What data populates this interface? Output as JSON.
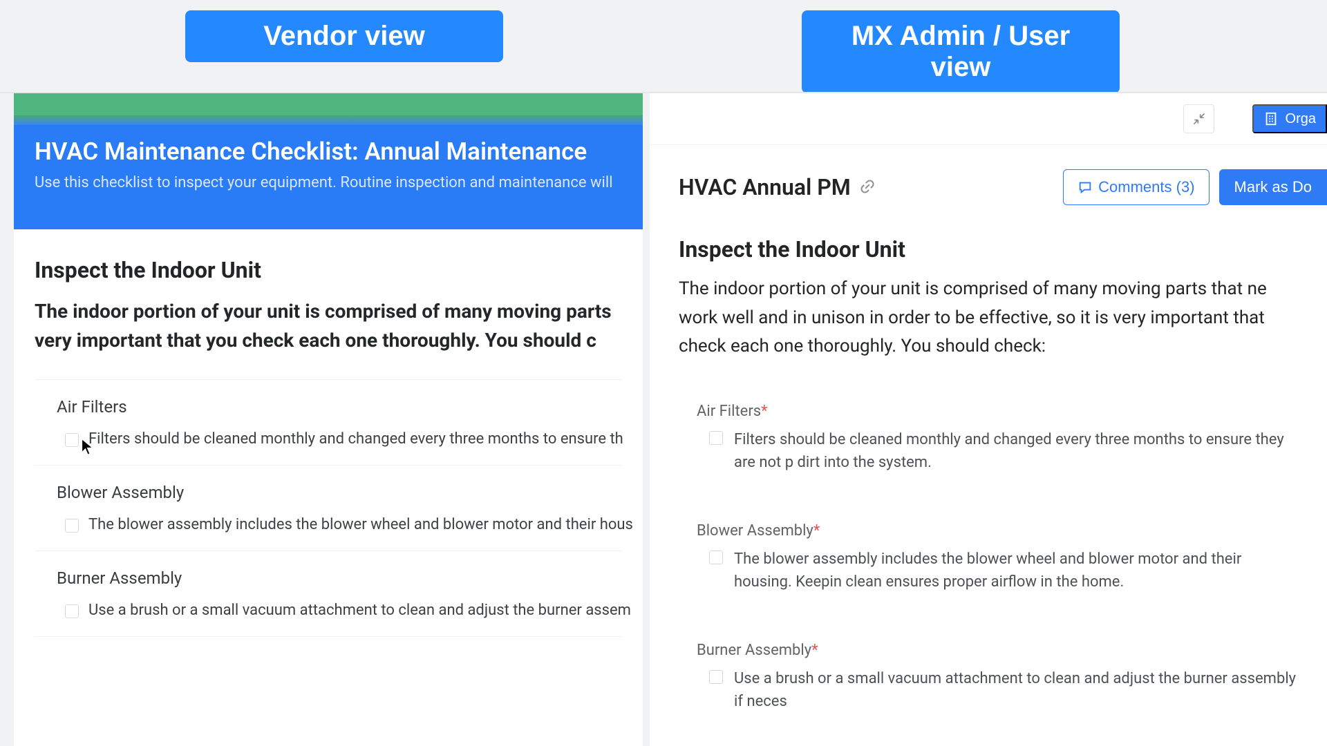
{
  "titles": {
    "vendor": "Vendor view",
    "admin": "MX Admin / User view"
  },
  "vendor": {
    "title": "HVAC Maintenance Checklist: Annual Maintenance",
    "subtitle": "Use this checklist to inspect your equipment. Routine inspection and maintenance will",
    "section_heading": "Inspect the Indoor Unit",
    "section_intro": "The indoor portion of your unit is comprised of many moving parts\nvery important that you check each one thoroughly. You should c",
    "items": [
      {
        "title": "Air Filters",
        "desc": "Filters should be cleaned monthly and changed every three months to ensure th"
      },
      {
        "title": "Blower Assembly",
        "desc": "The blower assembly includes the blower wheel and blower motor and their hous"
      },
      {
        "title": "Burner Assembly",
        "desc": "Use a brush or a small vacuum attachment to clean and adjust the burner assem"
      }
    ]
  },
  "admin": {
    "orga_label": "Orga",
    "heading": "HVAC Annual PM",
    "comments_label": "Comments (3)",
    "mark_done": "Mark as Do",
    "section_heading": "Inspect the Indoor Unit",
    "section_intro": "The indoor portion of your unit is comprised of many moving parts that ne work well and in unison in order to be effective, so it is very important that check each one thoroughly. You should check:",
    "items": [
      {
        "title": "Air Filters",
        "desc": "Filters should be cleaned monthly and changed every three months to ensure they are not p dirt into the system."
      },
      {
        "title": "Blower Assembly",
        "desc": "The blower assembly includes the blower wheel and blower motor and their housing. Keepin clean ensures proper airflow in the home."
      },
      {
        "title": "Burner Assembly",
        "desc": "Use a brush or a small vacuum attachment to clean and adjust the burner assembly if neces"
      }
    ]
  }
}
